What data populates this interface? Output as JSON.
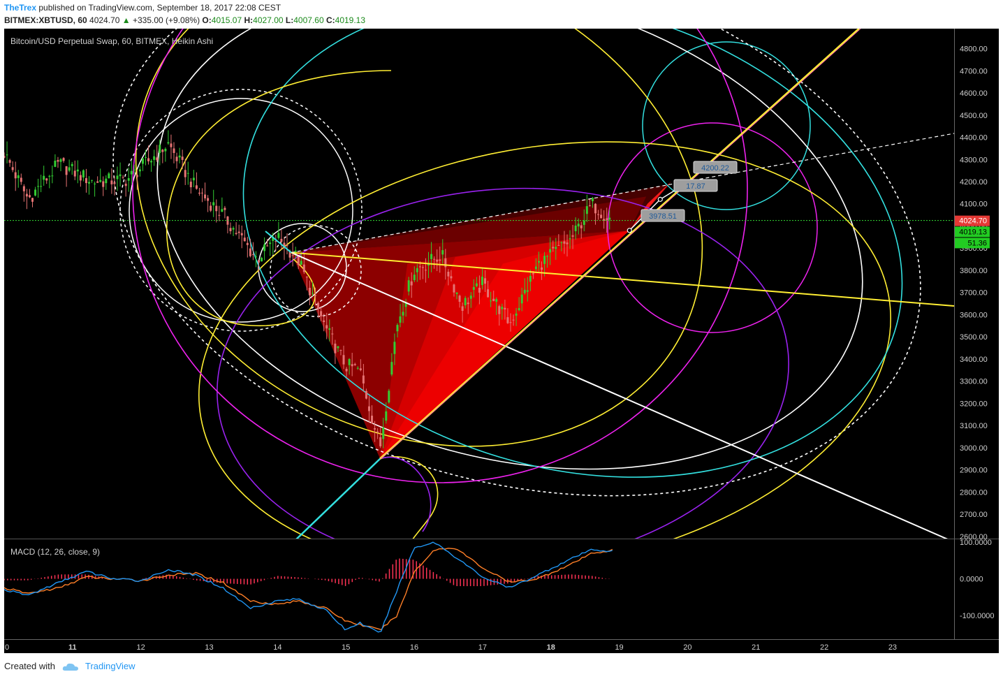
{
  "header": {
    "author": "TheTrex",
    "published_text": "published on TradingView.com, September 18, 2017 22:08 CEST",
    "symbol": "BITMEX:XBTUSD, 60",
    "last": "4024.70",
    "change": "+335.00 (+9.08%)",
    "o_label": "O:",
    "o": "4015.07",
    "h_label": "H:",
    "h": "4027.00",
    "l_label": "L:",
    "l": "4007.60",
    "c_label": "C:",
    "c": "4019.13"
  },
  "main_pane": {
    "legend": "Bitcoin/USD Perpetual Swap, 60, BITMEX, Heikin Ashi",
    "price_tags": [
      "4024.70",
      "4019.13",
      "51.36"
    ],
    "drawing_labels": [
      "4200.22",
      "17.87",
      "3978.51"
    ]
  },
  "macd_pane": {
    "legend": "MACD (12, 26, close, 9)"
  },
  "footer": {
    "created_with": "Created with",
    "brand": "TradingView"
  },
  "colors": {
    "background": "#000000",
    "bull": "#33cc33",
    "bear": "#e57373",
    "fan": "#ff0000",
    "yellow": "#ffee33",
    "cyan": "#33e0e0",
    "magenta": "#ee22ee",
    "purple": "#9922ee",
    "white": "#ffffff",
    "macd_line": "#2196f3",
    "signal_line": "#ff7f27",
    "histogram": "#ff3355"
  },
  "chart_data": [
    {
      "type": "candlestick",
      "style": "Heikin Ashi",
      "x": [
        "11",
        "12",
        "13",
        "14",
        "15",
        "16",
        "17",
        "18",
        "19",
        "20",
        "21",
        "22",
        "23"
      ],
      "x_first_tick": "0",
      "y_axis_ticks": [
        "4800.00",
        "4700.00",
        "4600.00",
        "4500.00",
        "4400.00",
        "4300.00",
        "4200.00",
        "4100.00",
        "4000.00",
        "3900.00",
        "3800.00",
        "3700.00",
        "3600.00",
        "3500.00",
        "3400.00",
        "3300.00",
        "3200.00",
        "3100.00",
        "3000.00",
        "2900.00",
        "2800.00",
        "2700.00",
        "2600.00"
      ],
      "ylim": [
        2590,
        4890
      ],
      "xlim": [
        10.0,
        23.9
      ],
      "path_points": [
        {
          "x": 10.0,
          "y": 4330
        },
        {
          "x": 10.35,
          "y": 4120
        },
        {
          "x": 10.8,
          "y": 4280
        },
        {
          "x": 11.3,
          "y": 4200
        },
        {
          "x": 11.8,
          "y": 4210
        },
        {
          "x": 12.4,
          "y": 4370
        },
        {
          "x": 12.8,
          "y": 4170
        },
        {
          "x": 13.2,
          "y": 4050
        },
        {
          "x": 13.7,
          "y": 3850
        },
        {
          "x": 14.0,
          "y": 3950
        },
        {
          "x": 14.3,
          "y": 3850
        },
        {
          "x": 14.7,
          "y": 3540
        },
        {
          "x": 15.0,
          "y": 3370
        },
        {
          "x": 15.2,
          "y": 3350
        },
        {
          "x": 15.5,
          "y": 3000
        },
        {
          "x": 15.75,
          "y": 3560
        },
        {
          "x": 16.0,
          "y": 3800
        },
        {
          "x": 16.4,
          "y": 3870
        },
        {
          "x": 16.7,
          "y": 3640
        },
        {
          "x": 17.0,
          "y": 3740
        },
        {
          "x": 17.4,
          "y": 3560
        },
        {
          "x": 17.8,
          "y": 3820
        },
        {
          "x": 18.3,
          "y": 3940
        },
        {
          "x": 18.6,
          "y": 4100
        },
        {
          "x": 18.9,
          "y": 4024
        }
      ],
      "last_price": 4024.7,
      "close_price": 4019.13
    },
    {
      "type": "line",
      "name": "MACD (12, 26, close, 9)",
      "y_axis_ticks": [
        "100.0000",
        "0.0000",
        "-100.0000"
      ],
      "ylim": [
        -165,
        108
      ],
      "macd_points": [
        {
          "x": 10.0,
          "y": -30
        },
        {
          "x": 10.35,
          "y": -45
        },
        {
          "x": 10.8,
          "y": -10
        },
        {
          "x": 11.2,
          "y": 20
        },
        {
          "x": 11.6,
          "y": 0
        },
        {
          "x": 12.0,
          "y": -5
        },
        {
          "x": 12.4,
          "y": 25
        },
        {
          "x": 12.8,
          "y": 10
        },
        {
          "x": 13.2,
          "y": -25
        },
        {
          "x": 13.6,
          "y": -80
        },
        {
          "x": 14.0,
          "y": -60
        },
        {
          "x": 14.3,
          "y": -55
        },
        {
          "x": 14.7,
          "y": -85
        },
        {
          "x": 15.0,
          "y": -140
        },
        {
          "x": 15.2,
          "y": -120
        },
        {
          "x": 15.5,
          "y": -150
        },
        {
          "x": 15.75,
          "y": -30
        },
        {
          "x": 16.0,
          "y": 85
        },
        {
          "x": 16.3,
          "y": 100
        },
        {
          "x": 16.6,
          "y": 60
        },
        {
          "x": 17.0,
          "y": 5
        },
        {
          "x": 17.4,
          "y": -25
        },
        {
          "x": 17.8,
          "y": 10
        },
        {
          "x": 18.3,
          "y": 55
        },
        {
          "x": 18.6,
          "y": 80
        },
        {
          "x": 18.9,
          "y": 75
        }
      ],
      "signal_points": [
        {
          "x": 10.0,
          "y": -25
        },
        {
          "x": 10.35,
          "y": -40
        },
        {
          "x": 10.8,
          "y": -25
        },
        {
          "x": 11.2,
          "y": 5
        },
        {
          "x": 11.6,
          "y": 0
        },
        {
          "x": 12.0,
          "y": -5
        },
        {
          "x": 12.4,
          "y": 10
        },
        {
          "x": 12.8,
          "y": 15
        },
        {
          "x": 13.2,
          "y": -10
        },
        {
          "x": 13.6,
          "y": -60
        },
        {
          "x": 14.0,
          "y": -70
        },
        {
          "x": 14.3,
          "y": -60
        },
        {
          "x": 14.7,
          "y": -80
        },
        {
          "x": 15.0,
          "y": -115
        },
        {
          "x": 15.2,
          "y": -125
        },
        {
          "x": 15.5,
          "y": -140
        },
        {
          "x": 15.75,
          "y": -100
        },
        {
          "x": 16.0,
          "y": 20
        },
        {
          "x": 16.3,
          "y": 80
        },
        {
          "x": 16.6,
          "y": 85
        },
        {
          "x": 17.0,
          "y": 30
        },
        {
          "x": 17.4,
          "y": -10
        },
        {
          "x": 17.8,
          "y": 0
        },
        {
          "x": 18.3,
          "y": 40
        },
        {
          "x": 18.6,
          "y": 70
        },
        {
          "x": 18.9,
          "y": 78
        }
      ]
    }
  ]
}
